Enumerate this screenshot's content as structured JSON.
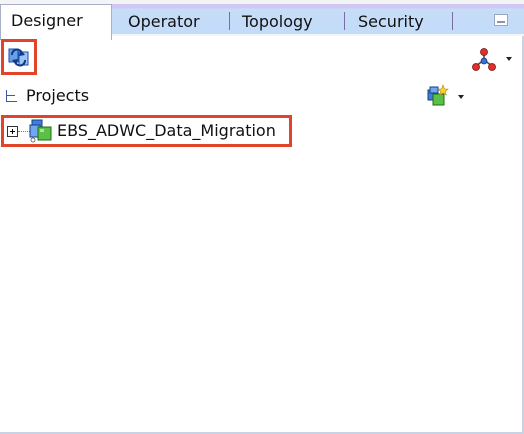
{
  "tabs": [
    {
      "label": "Designer",
      "active": true
    },
    {
      "label": "Operator",
      "active": false
    },
    {
      "label": "Topology",
      "active": false
    },
    {
      "label": "Security",
      "active": false
    }
  ],
  "toolbar": {
    "refresh_icon": "refresh-icon",
    "connect_icon": "connect-navigator-icon"
  },
  "projects": {
    "label": "Projects",
    "new_project_icon": "new-project-icon",
    "items": [
      {
        "label": "EBS_ADWC_Data_Migration",
        "icon": "project-icon",
        "expanded": false
      }
    ]
  },
  "colors": {
    "highlight": "#e0452b",
    "tab_stripe": "#c2dcf9",
    "tab_stripe_top": "#cfc8f4"
  }
}
